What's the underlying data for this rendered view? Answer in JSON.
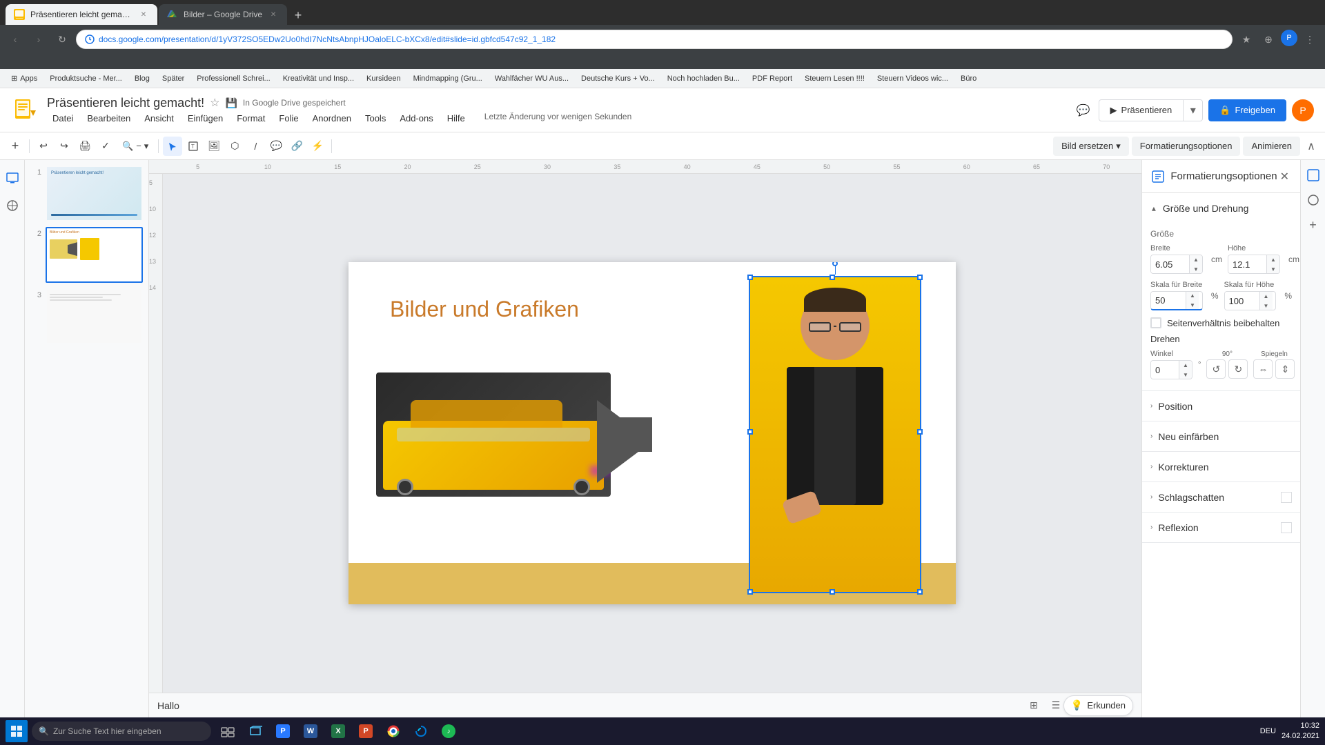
{
  "browser": {
    "tabs": [
      {
        "id": "tab1",
        "label": "Präsentieren leicht gemacht! – C...",
        "favicon_color": "#fbbc04",
        "active": true
      },
      {
        "id": "tab2",
        "label": "Bilder – Google Drive",
        "favicon_color": "#4285f4",
        "active": false
      }
    ],
    "address": "docs.google.com/presentation/d/1yV372SO5EDw2Uo0hdI7NcNtsAbnpHJOaloELC-bXCx8/edit#slide=id.gbfcd547c92_1_182",
    "nav": {
      "back_title": "Zurück",
      "forward_title": "Vorwärts",
      "refresh_title": "Seite neu laden"
    }
  },
  "bookmarks": [
    "Apps",
    "Produktsuche - Mer...",
    "Blog",
    "Später",
    "Professionell Schrei...",
    "Kreativität und Insp...",
    "Kursideen",
    "Mindmapping (Gru...",
    "Wahlfächer WU Aus...",
    "Deutsche Kurs + Vo...",
    "Noch hochladen Bu...",
    "PDF Report",
    "Steuern Lesen !!!!",
    "Steuern Videos wic...",
    "Büro"
  ],
  "app": {
    "title": "Präsentieren leicht gemacht!",
    "save_status": "In Google Drive gespeichert",
    "last_change": "Letzte Änderung vor wenigen Sekunden",
    "menu_items": [
      "Datei",
      "Bearbeiten",
      "Ansicht",
      "Einfügen",
      "Format",
      "Folie",
      "Anordnen",
      "Tools",
      "Add-ons",
      "Hilfe"
    ],
    "present_btn": "Präsentieren",
    "share_btn": "Freigeben",
    "avatar_letter": "P"
  },
  "toolbar": {
    "zoom_level": "−",
    "tools": [
      "Auswahl",
      "Textfeld",
      "Bild",
      "Form",
      "Linie",
      "Kommentar",
      "Verknüpfung",
      "Pfeile"
    ],
    "actions": [
      "Bild ersetzen ▾",
      "Formatierungsoptionen",
      "Animieren"
    ],
    "bild_ersetzen": "Bild ersetzen",
    "formatierungsoptionen": "Formatierungsoptionen",
    "animieren": "Animieren"
  },
  "slides": [
    {
      "number": "1",
      "active": false
    },
    {
      "number": "2",
      "active": true
    },
    {
      "number": "3",
      "active": false
    }
  ],
  "slide_content": {
    "title": "Bilder und Grafiken",
    "hallo": "Hallo",
    "erkunden_label": "Erkunden"
  },
  "format_panel": {
    "title": "Formatierungsoptionen",
    "sections": {
      "groesse_und_drehung": {
        "label": "Größe und Drehung",
        "expanded": true,
        "groesse": {
          "label": "Größe",
          "breite_label": "Breite",
          "breite_value": "6.05",
          "breite_unit": "cm",
          "hoehe_label": "Höhe",
          "hoehe_value": "12.1",
          "hoehe_unit": "cm"
        },
        "skala": {
          "breite_label": "Skala für Breite",
          "breite_value": "50",
          "breite_unit": "%",
          "hoehe_label": "Skala für Höhe",
          "hoehe_value": "100",
          "hoehe_unit": "%"
        },
        "seitenverhaeltnis": "Seitenverhältnis beibehalten",
        "drehen": {
          "label": "Drehen",
          "winkel_label": "Winkel",
          "winkel_value": "0",
          "ninety_label": "90°",
          "spiegeln_label": "Spiegeln"
        }
      },
      "position": {
        "label": "Position",
        "expanded": false
      },
      "neu_einfarben": {
        "label": "Neu einfärben",
        "expanded": false
      },
      "korrekturen": {
        "label": "Korrekturen",
        "expanded": false
      },
      "schlagschatten": {
        "label": "Schlagschatten",
        "expanded": false,
        "has_checkbox": true
      },
      "reflexion": {
        "label": "Reflexion",
        "expanded": false,
        "has_checkbox": true
      }
    }
  },
  "datetime": {
    "time": "10:32",
    "date": "24.02.2021"
  },
  "taskbar_icons": [
    "🪟",
    "📁",
    "📋",
    "📝",
    "📊",
    "📗",
    "🔍",
    "🌐",
    "🎵"
  ]
}
